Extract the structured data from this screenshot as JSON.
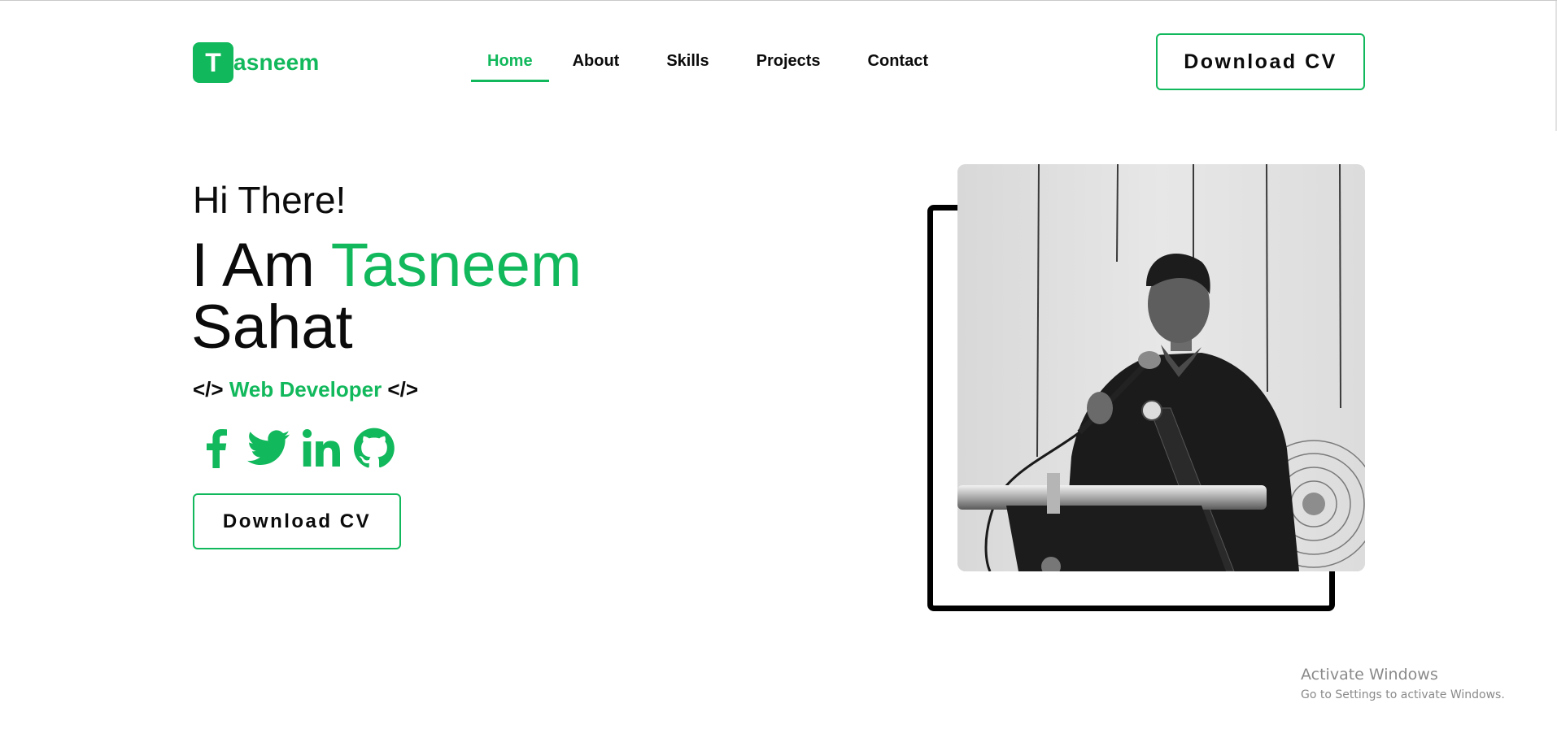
{
  "header": {
    "logo_letter": "T",
    "logo_rest": "asneem",
    "nav": [
      {
        "label": "Home",
        "active": true
      },
      {
        "label": "About",
        "active": false
      },
      {
        "label": "Skills",
        "active": false
      },
      {
        "label": "Projects",
        "active": false
      },
      {
        "label": "Contact",
        "active": false
      }
    ],
    "cv_button": "Download CV"
  },
  "hero": {
    "greeting": "Hi There!",
    "intro_prefix": "I Am",
    "first_name": "Tasneem",
    "last_name": "Sahat",
    "role_open": "</>",
    "role": "Web Developer",
    "role_close": "</>",
    "socials": [
      "facebook-icon",
      "twitter-icon",
      "linkedin-icon",
      "github-icon"
    ],
    "cv_button": "Download CV"
  },
  "watermark": {
    "title": "Activate Windows",
    "subtitle": "Go to Settings to activate Windows."
  },
  "colors": {
    "accent": "#12b85c",
    "text": "#0b0b0b",
    "background": "#ffffff"
  }
}
